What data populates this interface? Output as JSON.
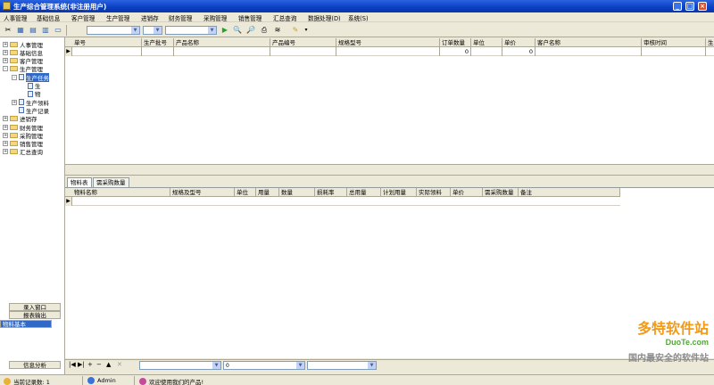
{
  "window": {
    "title": "生产综合管理系统(非注册用户)",
    "min": "_",
    "max": "□",
    "close": "×"
  },
  "menu": [
    "人事管理",
    "基础信息",
    "客户管理",
    "生产管理",
    "进销存",
    "财务管理",
    "采购管理",
    "销售管理",
    "汇总查询",
    "数据处理(D)",
    "系统(S)"
  ],
  "toolbar": {
    "icons": [
      "scissors-icon",
      "grid-icon",
      "list-icon",
      "chart-icon",
      "monitor-icon",
      "play-icon",
      "search-icon",
      "zoom-icon",
      "print-icon",
      "filter-icon",
      "pencil-icon"
    ],
    "combo1": "",
    "combo2": "",
    "combo3": ""
  },
  "tree": [
    {
      "label": "人事管理",
      "indent": 0,
      "pm": "+",
      "type": "folder"
    },
    {
      "label": "基础信息",
      "indent": 0,
      "pm": "+",
      "type": "folder"
    },
    {
      "label": "客户管理",
      "indent": 0,
      "pm": "+",
      "type": "folder"
    },
    {
      "label": "生产管理",
      "indent": 0,
      "pm": "-",
      "type": "folder"
    },
    {
      "label": "生产任务",
      "indent": 1,
      "pm": "-",
      "type": "doc",
      "selected": true
    },
    {
      "label": "生",
      "indent": 2,
      "pm": "",
      "type": "doc"
    },
    {
      "label": "物",
      "indent": 2,
      "pm": "",
      "type": "doc"
    },
    {
      "label": "生产领料",
      "indent": 1,
      "pm": "+",
      "type": "doc"
    },
    {
      "label": "生产记录",
      "indent": 1,
      "pm": "",
      "type": "doc"
    },
    {
      "label": "进销存",
      "indent": 0,
      "pm": "+",
      "type": "folder"
    },
    {
      "label": "财务管理",
      "indent": 0,
      "pm": "+",
      "type": "folder"
    },
    {
      "label": "采购管理",
      "indent": 0,
      "pm": "+",
      "type": "folder"
    },
    {
      "label": "销售管理",
      "indent": 0,
      "pm": "+",
      "type": "folder"
    },
    {
      "label": "汇总查询",
      "indent": 0,
      "pm": "+",
      "type": "folder"
    }
  ],
  "left_buttons": [
    "录入窗口",
    "报表输出",
    "物料基本",
    "信息分析"
  ],
  "grid1": {
    "columns": [
      "单号",
      "生产批号",
      "产品名称",
      "产品编号",
      "规格型号",
      "订单数量",
      "单位",
      "单价",
      "客户名称",
      "审核时间",
      "生"
    ],
    "row": [
      "",
      "",
      "",
      "",
      "",
      "0",
      "",
      "0",
      "",
      "",
      ""
    ]
  },
  "tabs": [
    "物料表",
    "需采购数量"
  ],
  "grid2": {
    "columns": [
      "物料名称",
      "规格及型号",
      "单位",
      "用量",
      "数量",
      "损耗率",
      "总用量",
      "计划用量",
      "实际领料",
      "单价",
      "需采购数量",
      "备注"
    ]
  },
  "navigator": {
    "symbols": [
      "|◀",
      "▶|",
      "+",
      "−",
      "▲",
      "✕"
    ],
    "combo3_value": "0"
  },
  "watermark": {
    "line1": "多特软件站",
    "line2": "DuoTe.com",
    "line3": "国内最安全的软件站"
  },
  "status": {
    "records": "当前记录数: 1",
    "user": "Admin",
    "welcome": "欢迎使用我们的产品!"
  }
}
